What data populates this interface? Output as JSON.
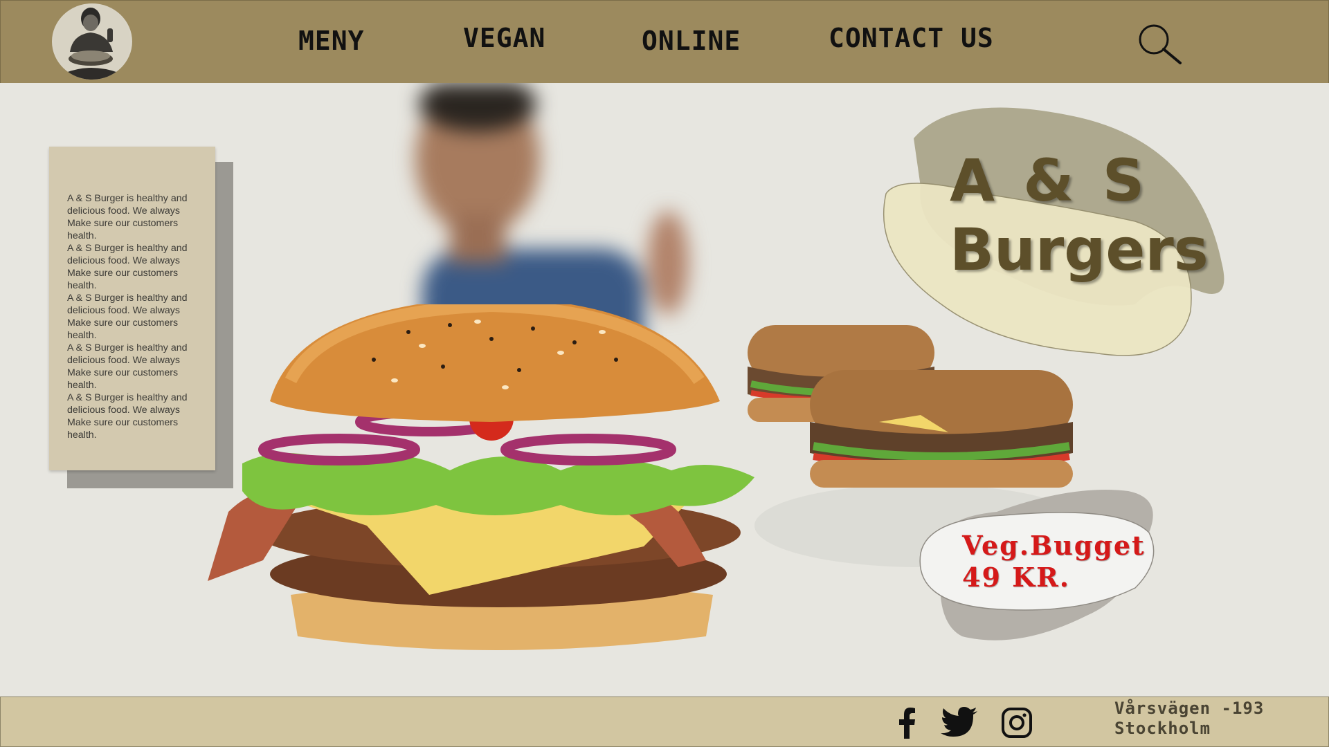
{
  "header": {
    "logo_icon": "chef-thumbs-up-logo",
    "nav": [
      {
        "label": "MENY"
      },
      {
        "label": "VEGAN"
      },
      {
        "label": "ONLINE"
      },
      {
        "label": "CONTACT US"
      }
    ],
    "search_icon": "search-icon"
  },
  "intro": {
    "text": "A & S  Burger is healthy and delicious food. We  always Make sure our customers health.\nA & S  Burger is healthy and delicious food. We  always Make sure our customers health.\nA & S  Burger is healthy and delicious food. We  always Make sure our customers health.\nA & S  Burger is healthy and delicious food. We  always Make sure our customers health.\nA & S  Burger is healthy and delicious food. We  always Make sure our customers health."
  },
  "brand": {
    "line1": "A & S",
    "line2": "Burgers"
  },
  "promo": {
    "line1": "Veg.Bugget",
    "line2": "49 KR."
  },
  "footer": {
    "social": [
      "facebook-icon",
      "twitter-icon",
      "instagram-icon"
    ],
    "address_line1": "Vårsvägen -193",
    "address_line2": "Stockholm"
  },
  "colors": {
    "header_bg": "#9c8a5e",
    "footer_bg": "#d2c6a1",
    "page_bg": "#e7e6e0",
    "brand_text": "#5d4f2a",
    "promo_text": "#d51919"
  }
}
